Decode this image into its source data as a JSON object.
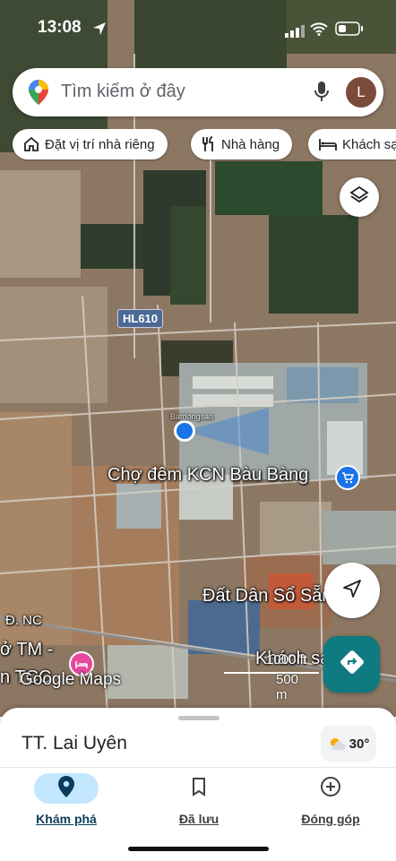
{
  "status_bar": {
    "time": "13:08"
  },
  "search": {
    "placeholder": "Tìm kiếm ở đây",
    "avatar_letter": "L"
  },
  "chips": [
    {
      "label": "Đặt vị trí nhà riêng",
      "icon": "home-icon"
    },
    {
      "label": "Nhà hàng",
      "icon": "restaurant-icon"
    },
    {
      "label": "Khách sạn",
      "icon": "hotel-icon"
    }
  ],
  "map": {
    "road_label": "HL610",
    "place_label_1": "Chợ đêm KCN Bàu Bàng",
    "place_label_2": "Đất Dân Sổ Sẵn",
    "road_nc": "Đ. NC",
    "tm_label": "ở TM -",
    "tm_label_2": "n TCC",
    "hotel_label": "Khách sạn",
    "logo": "Google Maps",
    "scale_ft": "1000 ft",
    "scale_m": "500 m",
    "watermark": "Batdongsan"
  },
  "sheet": {
    "place": "TT. Lai Uyên",
    "temperature": "30°"
  },
  "nav": [
    {
      "label": "Khám phá",
      "icon": "explore-pin-icon",
      "active": true
    },
    {
      "label": "Đã lưu",
      "icon": "bookmark-icon",
      "active": false
    },
    {
      "label": "Đóng góp",
      "icon": "add-circle-icon",
      "active": false
    }
  ],
  "colors": {
    "accent": "#1a73e8",
    "active_pill": "#c2e7ff",
    "directions": "#0f7a80"
  }
}
